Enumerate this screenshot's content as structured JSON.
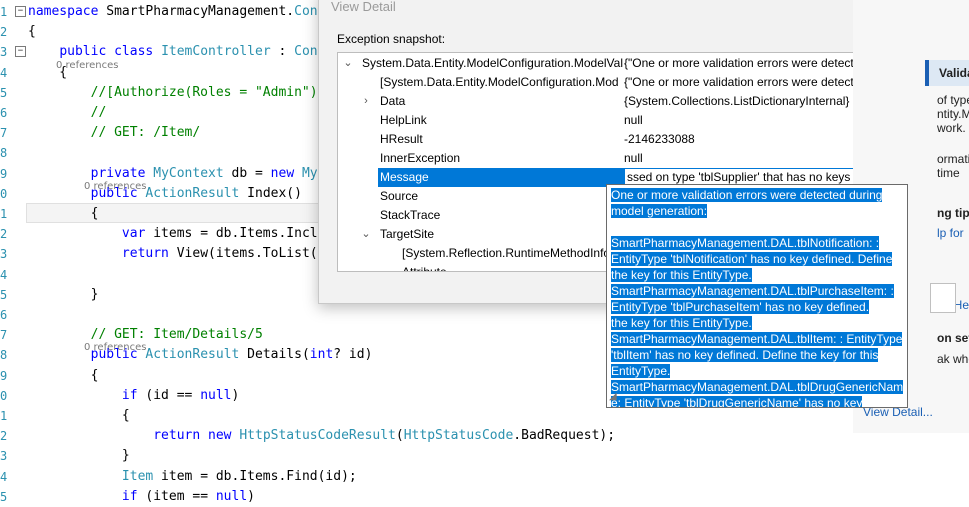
{
  "editor": {
    "lines": [
      {
        "n": "1",
        "t": "namespace SmartPharmacyManagement.Controll"
      },
      {
        "n": "2",
        "t": "{"
      },
      {
        "n": "3",
        "t": "    public class ItemController : Controll"
      },
      {
        "n": "4",
        "t": "    {"
      },
      {
        "n": "5",
        "t": "        //[Authorize(Roles = \"Admin\")]"
      },
      {
        "n": "6",
        "t": "        //"
      },
      {
        "n": "7",
        "t": "        // GET: /Item/"
      },
      {
        "n": "8",
        "t": ""
      },
      {
        "n": "9",
        "t": "        private MyContext db = new MyConte"
      },
      {
        "n": "0",
        "t": "        public ActionResult Index()"
      },
      {
        "n": "1",
        "t": "        {"
      },
      {
        "n": "2",
        "t": "            var items = db.Items.Include(i"
      },
      {
        "n": "3",
        "t": "            return View(items.ToList());"
      },
      {
        "n": "4",
        "t": ""
      },
      {
        "n": "5",
        "t": "        }"
      },
      {
        "n": "6",
        "t": ""
      },
      {
        "n": "7",
        "t": "        // GET: Item/Details/5"
      },
      {
        "n": "8",
        "t": "        public ActionResult Details(int? id)"
      },
      {
        "n": "9",
        "t": "        {"
      },
      {
        "n": "0",
        "t": "            if (id == null)"
      },
      {
        "n": "1",
        "t": "            {"
      },
      {
        "n": "2",
        "t": "                return new HttpStatusCodeResult(HttpStatusCode.BadRequest);"
      },
      {
        "n": "3",
        "t": "            }"
      },
      {
        "n": "4",
        "t": "            Item item = db.Items.Find(id);"
      },
      {
        "n": "5",
        "t": "            if (item == null)"
      }
    ],
    "references_label": "0 references"
  },
  "dialog": {
    "title": "View Detail",
    "close_glyph": "✕",
    "snapshot_label": "Exception snapshot:",
    "rows": [
      {
        "expander": "⌄",
        "name": "System.Data.Entity.ModelConfiguration.ModelVal",
        "value": "{\"One or more validation errors were detected during"
      },
      {
        "expander": "",
        "name": "[System.Data.Entity.ModelConfiguration.Mod",
        "value": "{\"One or more validation errors were detected during"
      },
      {
        "expander": "›",
        "name": "Data",
        "value": "{System.Collections.ListDictionaryInternal}"
      },
      {
        "expander": "",
        "name": "HelpLink",
        "value": "null"
      },
      {
        "expander": "",
        "name": "HResult",
        "value": "-2146233088"
      },
      {
        "expander": "",
        "name": "InnerException",
        "value": "null"
      },
      {
        "expander": "",
        "name": "Message",
        "value": "ssed on type 'tblSupplier' that has no keys defined."
      },
      {
        "expander": "",
        "name": "Source",
        "value": ""
      },
      {
        "expander": "",
        "name": "StackTrace",
        "value": ""
      },
      {
        "expander": "⌄",
        "name": "TargetSite",
        "value": ""
      },
      {
        "expander": "",
        "name": "[System.Reflection.RuntimeMethodInfo",
        "value": ""
      },
      {
        "expander": "",
        "name": "Attribute",
        "value": ""
      }
    ]
  },
  "popup": {
    "lines": [
      "One or more validation errors were detected during",
      "model generation:",
      "",
      "SmartPharmacyManagement.DAL.tblNotification: :",
      "EntityType 'tblNotification' has no key defined. Define",
      "the key for this EntityType.",
      "SmartPharmacyManagement.DAL.tblPurchaseItem: :",
      "EntityType 'tblPurchaseItem' has no key defined. Define",
      "the key for this EntityType.",
      "SmartPharmacyManagement.DAL.tblItem: : EntityType",
      "'tblItem' has no key defined. Define the key for this",
      "EntityType.",
      "SmartPharmacyManagement.DAL.tblDrugGenericNam",
      "e: EntityType 'tblDrugGenericName' has no key defined."
    ],
    "grip": "◢"
  },
  "right_panel": {
    "header": "Validation",
    "lines": [
      "of type",
      "ntity.M",
      "work."
    ],
    "info": [
      "ormati",
      "time"
    ],
    "tips_title": "ng tip",
    "tips_link": "lp for",
    "help_link": "ee Hel",
    "settings_title": "on settings:",
    "settings_text": "ak when this",
    "view_detail_link": "View Detail..."
  }
}
